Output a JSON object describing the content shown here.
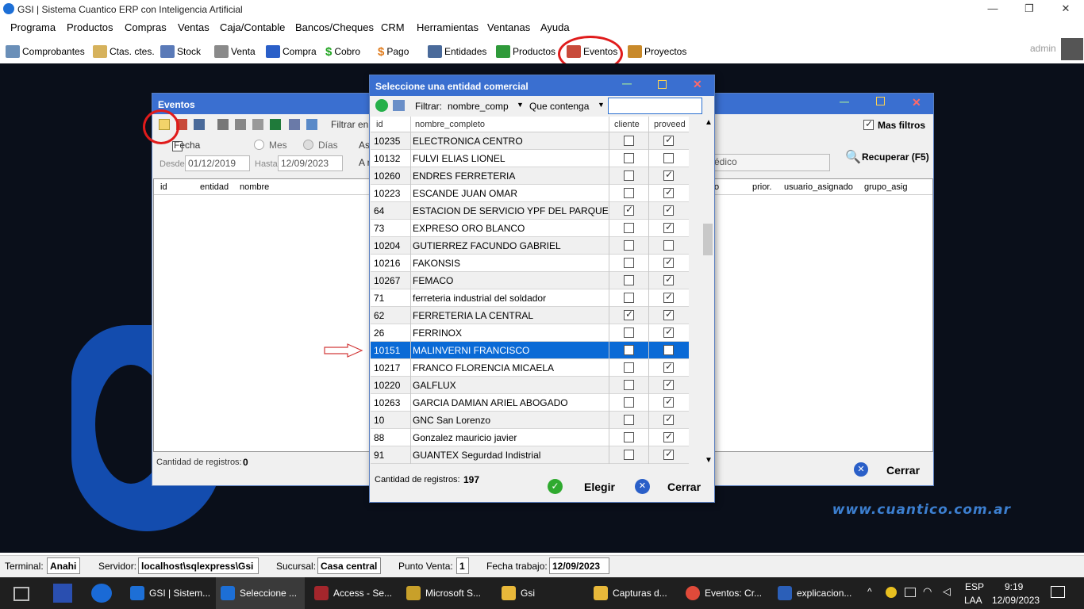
{
  "app": {
    "title": "GSI | Sistema Cuantico ERP con Inteligencia Artificial",
    "user": "admin"
  },
  "window_controls": {
    "minimize": "—",
    "restore": "❐",
    "close": "✕"
  },
  "menu": [
    "Programa",
    "Productos",
    "Compras",
    "Ventas",
    "Caja/Contable",
    "Bancos/Cheques",
    "CRM",
    "Herramientas",
    "Ventanas",
    "Ayuda"
  ],
  "toolbar": [
    "Comprobantes",
    "Ctas. ctes.",
    "Stock",
    "Venta",
    "Compra",
    "Cobro",
    "Pago",
    "Entidades",
    "Productos",
    "Eventos",
    "Proyectos"
  ],
  "toolbar_icons": [
    "documents-icon",
    "folder-icon",
    "boxes-icon",
    "printer-icon",
    "cart-icon",
    "dollar-icon",
    "dollar-icon",
    "list-icon",
    "cube-icon",
    "event-icon",
    "chart-icon"
  ],
  "desktop": {
    "website": "www.cuantico.com.ar"
  },
  "eventos": {
    "title": "Eventos",
    "filter_label": "Filtrar en",
    "mas_filtros": "Mas filtros",
    "fecha": "Fecha",
    "mes": "Mes",
    "dias": "Días",
    "asig_prefix": "Asi",
    "desde_label": "Desde",
    "desde_value": "01/12/2019",
    "hasta_label": "Hasta",
    "hasta_value": "12/09/2023",
    "combo_prefix": "A r",
    "medico_value": "édico",
    "recuperar": "Recuperar (F5)",
    "columns": [
      "id",
      "entidad",
      "nombre",
      "o",
      "prior.",
      "usuario_asignado",
      "grupo_asig"
    ],
    "count_label": "Cantidad de registros:",
    "count_value": "0",
    "close": "Cerrar"
  },
  "selector": {
    "title": "Seleccione una entidad comercial",
    "filter_label": "Filtrar:",
    "filter_field": "nombre_comp",
    "filter_mode": "Que contenga",
    "filter_text": "",
    "columns": {
      "id": "id",
      "name": "nombre_completo",
      "cliente": "cliente",
      "proveed": "proveed"
    },
    "rows": [
      {
        "id": "10235",
        "name": "ELECTRONICA CENTRO",
        "cliente": false,
        "proveed": true
      },
      {
        "id": "10132",
        "name": "FULVI ELIAS LIONEL",
        "cliente": false,
        "proveed": false
      },
      {
        "id": "10260",
        "name": "ENDRES FERRETERIA",
        "cliente": false,
        "proveed": true
      },
      {
        "id": "10223",
        "name": "ESCANDE JUAN OMAR",
        "cliente": false,
        "proveed": true
      },
      {
        "id": "64",
        "name": "ESTACION DE SERVICIO YPF DEL PARQUE",
        "cliente": true,
        "proveed": true
      },
      {
        "id": "73",
        "name": "EXPRESO ORO BLANCO",
        "cliente": false,
        "proveed": true
      },
      {
        "id": "10204",
        "name": "GUTIERREZ FACUNDO GABRIEL",
        "cliente": false,
        "proveed": false
      },
      {
        "id": "10216",
        "name": "FAKONSIS",
        "cliente": false,
        "proveed": true
      },
      {
        "id": "10267",
        "name": "FEMACO",
        "cliente": false,
        "proveed": true
      },
      {
        "id": "71",
        "name": "ferreteria industrial del soldador",
        "cliente": false,
        "proveed": true
      },
      {
        "id": "62",
        "name": "FERRETERIA LA CENTRAL",
        "cliente": true,
        "proveed": true
      },
      {
        "id": "26",
        "name": "FERRINOX",
        "cliente": false,
        "proveed": true
      },
      {
        "id": "10151",
        "name": "MALINVERNI FRANCISCO",
        "cliente": false,
        "proveed": false,
        "selected": true
      },
      {
        "id": "10217",
        "name": "FRANCO FLORENCIA MICAELA",
        "cliente": false,
        "proveed": true
      },
      {
        "id": "10220",
        "name": "GALFLUX",
        "cliente": false,
        "proveed": true
      },
      {
        "id": "10263",
        "name": "GARCIA DAMIAN ARIEL ABOGADO",
        "cliente": false,
        "proveed": true
      },
      {
        "id": "10",
        "name": "GNC San Lorenzo",
        "cliente": false,
        "proveed": true
      },
      {
        "id": "88",
        "name": "Gonzalez mauricio javier",
        "cliente": false,
        "proveed": true
      },
      {
        "id": "91",
        "name": "GUANTEX Segurdad Indistrial",
        "cliente": false,
        "proveed": true
      }
    ],
    "count_label": "Cantidad de registros:",
    "count_value": "197",
    "choose": "Elegir",
    "close": "Cerrar"
  },
  "status": {
    "terminal_label": "Terminal:",
    "terminal": "Anahi",
    "server_label": "Servidor:",
    "server": "localhost\\sqlexpress\\Gsi",
    "branch_label": "Sucursal:",
    "branch": "Casa central",
    "pos_label": "Punto Venta:",
    "pos": "1",
    "date_label": "Fecha trabajo:",
    "date": "12/09/2023"
  },
  "taskbar": {
    "items": [
      "GSI | Sistem...",
      "Seleccione ...",
      "Access - Se...",
      "Microsoft S...",
      "Gsi",
      "Capturas d...",
      "Eventos: Cr...",
      "explicacion..."
    ],
    "lang1": "ESP",
    "lang2": "LAA",
    "time": "9:19",
    "date": "12/09/2023"
  },
  "colors": {
    "accent": "#3a6fd0",
    "selection": "#0a6ad6",
    "highlight_ring": "#e01b1b"
  }
}
